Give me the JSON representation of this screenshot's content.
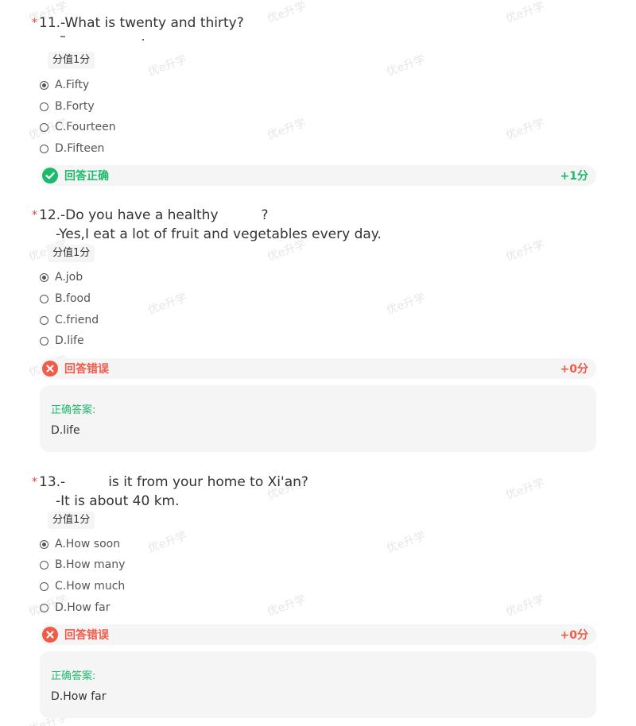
{
  "watermark": {
    "text": "优e升学"
  },
  "questions": [
    {
      "required_mark": "*",
      "title": "11.-What is twenty and thirty?",
      "subtitle": "",
      "score_tag": "分值1分",
      "options": [
        {
          "label": "A.Fifty",
          "selected": true
        },
        {
          "label": "B.Forty",
          "selected": false
        },
        {
          "label": "C.Fourteen",
          "selected": false
        },
        {
          "label": "D.Fifteen",
          "selected": false
        }
      ],
      "result": {
        "text": "回答正确",
        "score": "+1分",
        "status": "correct"
      }
    },
    {
      "required_mark": "*",
      "title": "12.-Do you have a healthy          ?",
      "subtitle": "-Yes,I eat a lot of fruit and vegetables every day.",
      "score_tag": "分值1分",
      "options": [
        {
          "label": "A.job",
          "selected": true
        },
        {
          "label": "B.food",
          "selected": false
        },
        {
          "label": "C.friend",
          "selected": false
        },
        {
          "label": "D.life",
          "selected": false
        }
      ],
      "result": {
        "text": "回答错误",
        "score": "+0分",
        "status": "wrong"
      },
      "correct_answer": {
        "label": "正确答案:",
        "value": "D.life"
      }
    },
    {
      "required_mark": "*",
      "title": "13.-          is it from your home to Xi'an?",
      "subtitle": "-It is about 40 km.",
      "score_tag": "分值1分",
      "options": [
        {
          "label": "A.How soon",
          "selected": true
        },
        {
          "label": "B.How many",
          "selected": false
        },
        {
          "label": "C.How much",
          "selected": false
        },
        {
          "label": "D.How far",
          "selected": false
        }
      ],
      "result": {
        "text": "回答错误",
        "score": "+0分",
        "status": "wrong"
      },
      "correct_answer": {
        "label": "正确答案:",
        "value": "D.How far"
      }
    }
  ],
  "colors": {
    "correct": "#1dba6b",
    "wrong": "#f05a49",
    "required": "#e2463b",
    "panel_bg": "#f5f5f5"
  }
}
